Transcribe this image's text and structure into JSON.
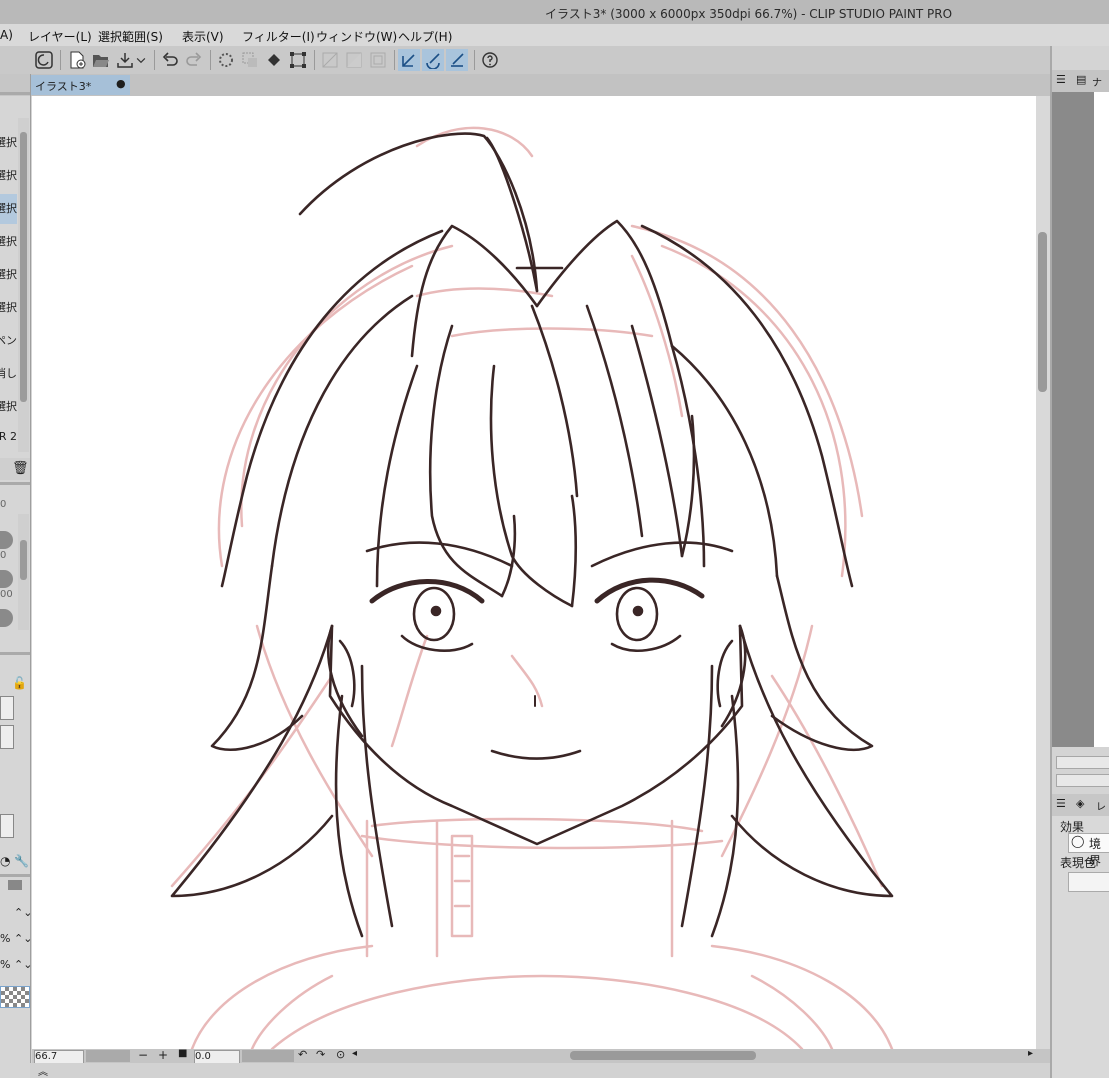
{
  "window": {
    "title": "イラスト3* (3000 x 6000px 350dpi 66.7%)  - CLIP STUDIO PAINT PRO"
  },
  "menu": {
    "items": [
      "A)",
      "レイヤー(L)",
      "選択範囲(S)",
      "表示(V)",
      "フィルター(I)",
      "ウィンドウ(W)",
      "ヘルプ(H)"
    ]
  },
  "toolbar": {
    "icons": [
      "clip-studio-icon",
      "new-canvas-icon",
      "open-file-icon",
      "save-icon",
      "dropdown-arrow-icon",
      "undo-icon",
      "redo-icon",
      "loading-icon",
      "clear-selection-icon",
      "fill-icon",
      "transform-icon",
      "snap-off-icon",
      "snap-ruler-icon",
      "snap-grid-icon",
      "stabilize-pen-icon",
      "stabilize-brush-icon",
      "stabilize-ruler-icon",
      "help-icon"
    ]
  },
  "document_tab": {
    "label": "イラスト3*",
    "modified_dot": "●"
  },
  "left_panel": {
    "sub_tools": [
      "選択",
      "選択",
      "選択",
      "選択",
      "選択",
      "選択",
      "ペン",
      "消し",
      "選択",
      "R 2"
    ],
    "selected_index": 2,
    "slider_values": [
      "0",
      "0",
      "00"
    ],
    "percent_labels": [
      "%",
      "%"
    ]
  },
  "status": {
    "zoom": "66.7",
    "rotation": "0.0"
  },
  "right_panel": {
    "navigator_tab": "ナビ",
    "layer_tab": "レイ",
    "effect_label": "効果",
    "boundary_label": "境界",
    "display_color_label": "表現色"
  },
  "colors": {
    "selection": "#a9c4dc",
    "lineart": "#3a2626",
    "sketch": "#e4b2b2"
  }
}
